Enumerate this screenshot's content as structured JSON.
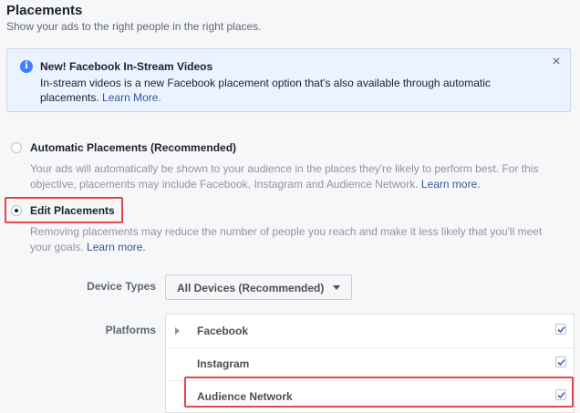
{
  "section": {
    "title": "Placements",
    "subtitle": "Show your ads to the right people in the right places."
  },
  "banner": {
    "title": "New! Facebook In-Stream Videos",
    "body": "In-stream videos is a new Facebook placement option that's also available through automatic placements.",
    "link": "Learn More.",
    "info_glyph": "i",
    "close_glyph": "×"
  },
  "placement_options": [
    {
      "label": "Automatic Placements (Recommended)",
      "selected": false,
      "description": "Your ads will automatically be shown to your audience in the places they're likely to perform best. For this objective, placements may include Facebook, Instagram and Audience Network.",
      "link": "Learn more."
    },
    {
      "label": "Edit Placements",
      "selected": true,
      "description": "Removing placements may reduce the number of people you reach and make it less likely that you'll meet your goals.",
      "link": "Learn more."
    }
  ],
  "device_types": {
    "label": "Device Types",
    "selected": "All Devices (Recommended)"
  },
  "platforms": {
    "label": "Platforms",
    "items": [
      {
        "name": "Facebook",
        "checked": true,
        "expandable": true
      },
      {
        "name": "Instagram",
        "checked": true,
        "expandable": false
      },
      {
        "name": "Audience Network",
        "checked": true,
        "expandable": false
      }
    ]
  },
  "colors": {
    "highlight": "#e2474b",
    "link": "#365899",
    "info": "#4080ff",
    "checkmark": "#4267b2"
  }
}
